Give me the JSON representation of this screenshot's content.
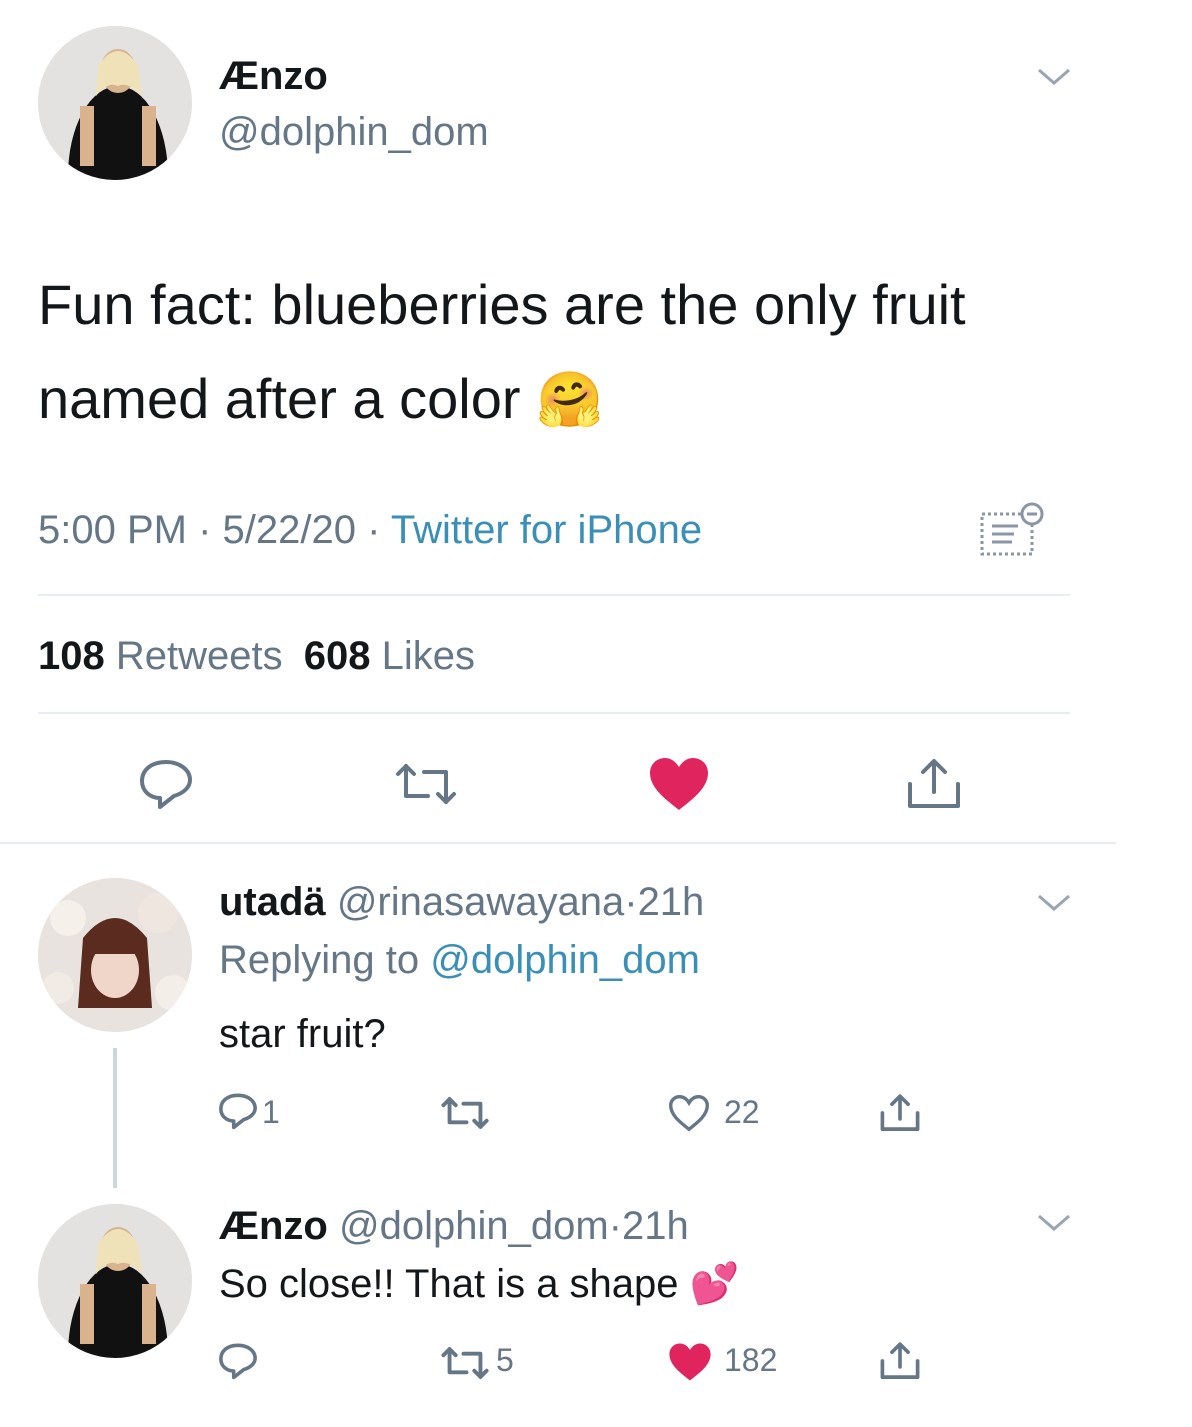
{
  "main_tweet": {
    "display_name": "Ænzo",
    "handle": "@dolphin_dom",
    "text": "Fun fact: blueberries are the only fruit named after a color",
    "emoji": "🤗",
    "time": "5:00 PM",
    "date": "5/22/20",
    "source": "Twitter for iPhone",
    "retweets_count": "108",
    "retweets_label": "Retweets",
    "likes_count": "608",
    "likes_label": "Likes",
    "liked": true
  },
  "replies": [
    {
      "display_name": "utadä",
      "handle": "@rinasawayana",
      "age": "21h",
      "replying_label": "Replying to",
      "replying_to": "@dolphin_dom",
      "text": "star fruit?",
      "reply_count": "1",
      "retweet_count": "",
      "like_count": "22",
      "liked": false
    },
    {
      "display_name": "Ænzo",
      "handle": "@dolphin_dom",
      "age": "21h",
      "text": "So close!! That is a shape",
      "emoji": "💕",
      "reply_count": "",
      "retweet_count": "5",
      "like_count": "182",
      "liked": true
    }
  ],
  "separator": "·",
  "colors": {
    "like_red": "#e0245e",
    "link_blue": "#3a8fb7",
    "meta_grey": "#657786",
    "divider": "#e6ecf0"
  },
  "icons": [
    "chevron-down-icon",
    "reply-icon",
    "retweet-icon",
    "heart-icon",
    "share-icon",
    "analytics-icon"
  ]
}
